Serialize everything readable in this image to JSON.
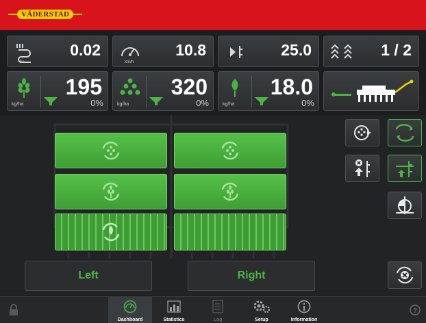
{
  "brand": "VÄDERSTAD",
  "stats": {
    "area": {
      "value": "0.02",
      "unit": "ha"
    },
    "speed": {
      "value": "10.8",
      "unit": "km/h"
    },
    "marker": {
      "value": "25.0"
    },
    "tramline": {
      "value": "1 / 2"
    }
  },
  "rates": [
    {
      "value": "195",
      "unit": "kg/ha",
      "percent": "0%"
    },
    {
      "value": "320",
      "unit": "kg/ha",
      "percent": "0%"
    },
    {
      "value": "18.0",
      "unit": "kg/ha",
      "percent": "0%"
    }
  ],
  "sections": {
    "left_label": "Left",
    "right_label": "Right"
  },
  "nav": [
    {
      "label": "Dashboard"
    },
    {
      "label": "Statistics"
    },
    {
      "label": "Log"
    },
    {
      "label": "Setup"
    },
    {
      "label": "Information"
    }
  ],
  "colors": {
    "brand_red": "#d7141b",
    "accent_green": "#4cb446",
    "brand_yellow": "#f2d000"
  }
}
